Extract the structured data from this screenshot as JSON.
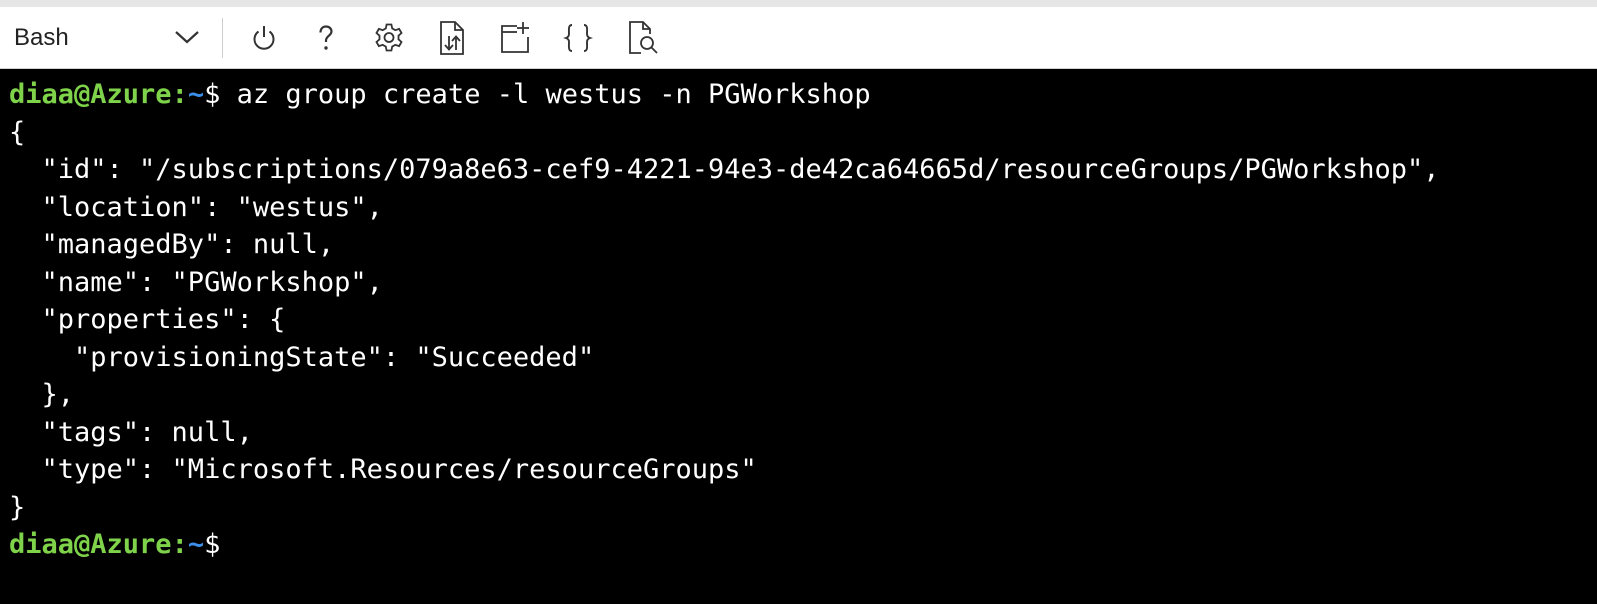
{
  "toolbar": {
    "shell_label": "Bash",
    "buttons": [
      {
        "name": "restart",
        "icon": "power-icon"
      },
      {
        "name": "help",
        "icon": "help-icon"
      },
      {
        "name": "settings",
        "icon": "gear-icon"
      },
      {
        "name": "upload-download",
        "icon": "upload-download-icon"
      },
      {
        "name": "new-session",
        "icon": "new-session-icon"
      },
      {
        "name": "editor",
        "icon": "braces-icon"
      },
      {
        "name": "web-preview",
        "icon": "web-preview-icon"
      }
    ]
  },
  "terminal": {
    "prompt": {
      "user_host": "diaa@Azure",
      "separator": ":",
      "path": "~",
      "symbol": "$"
    },
    "command": " az group create -l westus -n PGWorkshop",
    "output_lines": [
      "{",
      "  \"id\": \"/subscriptions/079a8e63-cef9-4221-94e3-de42ca64665d/resourceGroups/PGWorkshop\",",
      "  \"location\": \"westus\",",
      "  \"managedBy\": null,",
      "  \"name\": \"PGWorkshop\",",
      "  \"properties\": {",
      "    \"provisioningState\": \"Succeeded\"",
      "  },",
      "  \"tags\": null,",
      "  \"type\": \"Microsoft.Resources/resourceGroups\"",
      "}"
    ]
  },
  "colors": {
    "terminal_bg": "#000000",
    "terminal_fg": "#ffffff",
    "prompt_user": "#7fd34a",
    "prompt_path": "#3b8eea",
    "toolbar_bg": "#ffffff"
  }
}
